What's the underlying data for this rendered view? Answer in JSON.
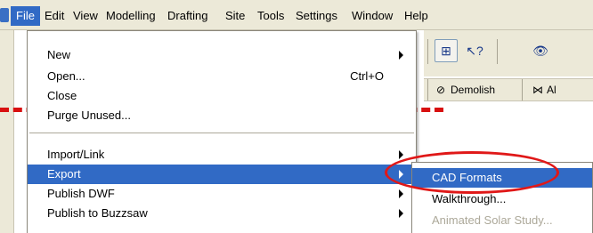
{
  "menubar": {
    "items": [
      {
        "label": "File",
        "active": true
      },
      {
        "label": "Edit"
      },
      {
        "label": "View"
      },
      {
        "label": "Modelling"
      },
      {
        "label": "Drafting"
      },
      {
        "label": "Site"
      },
      {
        "label": "Tools"
      },
      {
        "label": "Settings"
      },
      {
        "label": "Window"
      },
      {
        "label": "Help"
      }
    ]
  },
  "toolbar": {
    "demolish_label": "Demolish",
    "partial_label": "Al"
  },
  "file_menu": {
    "items": [
      {
        "label": "New",
        "submenu": true
      },
      {
        "label": "Open...",
        "shortcut": "Ctrl+O"
      },
      {
        "label": "Close"
      },
      {
        "label": "Purge Unused..."
      },
      {
        "label": "Import/Link",
        "submenu": true
      },
      {
        "label": "Export",
        "submenu": true,
        "highlighted": true
      },
      {
        "label": "Publish DWF",
        "submenu": true
      },
      {
        "label": "Publish to Buzzsaw",
        "submenu": true
      }
    ]
  },
  "export_submenu": {
    "items": [
      {
        "label": "CAD Formats",
        "highlighted": true
      },
      {
        "label": "Walkthrough..."
      },
      {
        "label": "Animated Solar Study...",
        "disabled": true
      }
    ]
  },
  "colors": {
    "highlight": "#316ac5",
    "menubar_bg": "#ece9d8",
    "annotation_red": "#e01818"
  }
}
